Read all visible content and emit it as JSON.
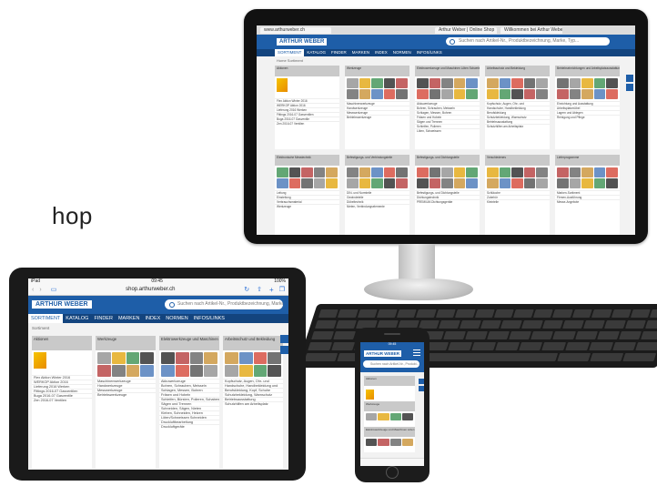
{
  "side_text": "hop",
  "desktop": {
    "tabs": [
      "www.arthurweber.ch",
      "Arthur Weber | Online Shop",
      "Willkommen bei Arthur Weber"
    ],
    "logo": "ARTHUR WEBER",
    "search_placeholder": "Suchen nach Artikel-Nr., Produktbezeichnung, Marke, Typ...",
    "nav": [
      "SORTIMENT",
      "KATALOG",
      "FINDER",
      "MARKEN",
      "INDEX",
      "NORMEN",
      "INFOS/LINKS"
    ],
    "breadcrumb": "Home  Sortiment",
    "cards": [
      {
        "title": "Aktionen",
        "items": [
          "Flex Aktion Winter 2016",
          "WERKOP Aktion 2016",
          "Lieferung 2016 Werken",
          "Fittings 2016-07 Gasventilen",
          "Buga 2016-07 Gasventile",
          "Zen 2016-07 Ventilen"
        ]
      },
      {
        "title": "Werkzeuge",
        "items": [
          "Maschinenwerkzeuge",
          "Handwerkzeuge",
          "Messwerkzeuge",
          "Betriebswerkzeuge"
        ]
      },
      {
        "title": "Elektrowerkzeuge und Maschinen Löten Schweissen Druckluftgeräte",
        "items": [
          "Akkuwerkzeuge",
          "Bohren, Schrauben, Meisseln",
          "Schlagen, Messen, Bohren",
          "Fräsen und Hobeln",
          "Sägen und Trennen",
          "Schleifen, Polieren",
          "Löten, Schweissen"
        ]
      },
      {
        "title": "Arbeitsschutz und Bekleidung",
        "items": [
          "Kopfschutz, Augen, Ohr- und",
          "Handschuhe, Handbekleidung",
          "Berufskleidung",
          "Schutzbekleidung, Warnschutz",
          "Betriebsausstattung",
          "Schutzhilfen am Arbeitsplatz"
        ]
      },
      {
        "title": "Betriebseinrichtungen und Arbeitsplatzausstattungen",
        "items": [
          "Einrichtung und Ausstattung",
          "Arbeitsplatzmöbel",
          "Lagern und Ablegen",
          "Reinigung und Pflege"
        ]
      },
      {
        "title": "Elektronische Messtechnik",
        "items": [
          "Leitung",
          "Einstellung",
          "Verbrauchsmaterial",
          "Werkzeuge"
        ]
      },
      {
        "title": "Befestigungs- und Verbindungsteile",
        "items": [
          "DIN- und Normteile",
          "Gewindeteile",
          "Dübeltechnik",
          "Nieten, Verbindungselemente"
        ]
      },
      {
        "title": "Befestigungs- und Dichtungsteile",
        "items": [
          "Befestigungs- und Dichtungsteile",
          "Dichtungstechnik",
          "PREMIUM-Dichtungsgeräte"
        ]
      },
      {
        "title": "Verschiedenes",
        "items": [
          "Schläuche",
          "Zubehör",
          "Kleinteile"
        ]
      },
      {
        "title": "Lieferprogramme",
        "items": [
          "Marken-Sortiment",
          "Firmen-Ausführung",
          "Messe-Angebote"
        ]
      }
    ]
  },
  "tablet": {
    "time": "09:45",
    "carrier": "iPad",
    "battery": "100%",
    "url": "shop.arthurweber.ch",
    "logo": "ARTHUR WEBER",
    "search_placeholder": "Suchen nach Artikel-Nr., Produktbezeichnung, Marke, Ty",
    "nav": [
      "SORTIMENT",
      "KATALOG",
      "FINDER",
      "MARKEN",
      "INDEX",
      "NORMEN",
      "INFOS/LINKS"
    ],
    "breadcrumb": "Sortiment",
    "cards": [
      {
        "title": "Aktionen",
        "items": [
          "Flex Aktion Winter 2016",
          "WERKOP Aktion 2016",
          "Lieferung 2016 Werken",
          "Fittings 2016-07 Gasventilen",
          "Buga 2016-07 Gasventile",
          "Zen 2016-07 Ventilen"
        ]
      },
      {
        "title": "Werkzeuge",
        "items": [
          "Maschinenwerkzeuge",
          "Handwerkzeuge",
          "Messwerkzeuge",
          "Betriebswerkzeuge"
        ]
      },
      {
        "title": "Elektrowerkzeuge und Maschinen Löten Schweissen Druckluftgeräte",
        "items": [
          "Akkuwerkzeuge",
          "Bohren, Schrauben, Meisseln",
          "Schlagen, Messen, Bohren",
          "Fräsen und Hobeln",
          "Schleifen, Bürsten, Polieren, Schaben",
          "Sägen und Trennen",
          "Schneiden, Sägen, Nieten",
          "Kleben, Schneiden, Heizen",
          "Löten/Schweissen Schneiden",
          "Druckluftbearbeitung",
          "Druckluftgeräte"
        ]
      },
      {
        "title": "Arbeitsschutz und Bekleidung",
        "items": [
          "Kopfschutz, Augen, Ohr- und",
          "Handschuhe, Handbekleidung und",
          "Berufskleidung, Kopf, Schuhe",
          "Schutzbekleidung, Warnschutz",
          "Betriebsausstattung",
          "Schutzhilfen am Arbeitsplatz"
        ]
      }
    ]
  },
  "phone": {
    "time": "09:45",
    "logo": "ARTHUR WEBER",
    "search_placeholder": "Suchen nach Artikel-Nr., Produkt...",
    "cards": [
      {
        "title": "Aktionen"
      },
      {
        "title": "Werkzeuge"
      },
      {
        "title": "Elektrowerkzeuge und Maschinen Löten Schweissen Druckluftgeräte"
      }
    ]
  },
  "colors": {
    "brand_blue": "#1e5ea8",
    "nav_dark": "#13447e",
    "card_head": "#c9c9c9"
  }
}
